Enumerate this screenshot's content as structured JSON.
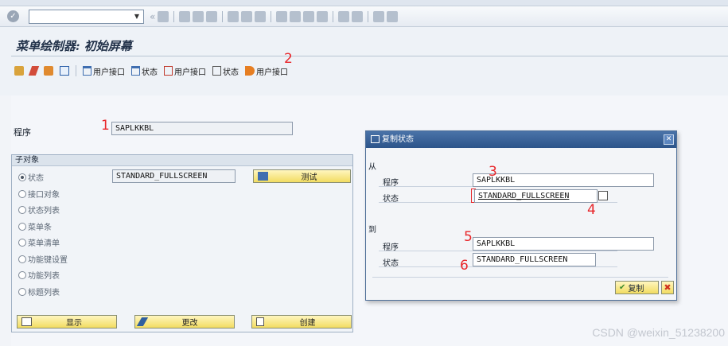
{
  "toolbar": {
    "ok_glyph": "✓",
    "command_field_value": "",
    "nav_glyph": "«"
  },
  "screen": {
    "title": "菜单绘制器: 初始屏幕"
  },
  "app_toolbar": {
    "items": [
      {
        "label": "用户接口",
        "icon": "trash-icon"
      },
      {
        "label": "状态",
        "icon": "trash-icon"
      },
      {
        "label": "用户接口",
        "icon": "copy-icon"
      },
      {
        "label": "状态",
        "icon": "copy-icon"
      },
      {
        "label": "用户接口",
        "icon": "properties-icon"
      }
    ]
  },
  "program": {
    "label": "程序",
    "value": "SAPLKKBL"
  },
  "subobjects": {
    "header": "子对象",
    "status_value": "STANDARD_FULLSCREEN",
    "radios": [
      {
        "label": "状态",
        "selected": true
      },
      {
        "label": "接口对象",
        "selected": false
      },
      {
        "label": "状态列表",
        "selected": false
      },
      {
        "label": "菜单条",
        "selected": false
      },
      {
        "label": "菜单清单",
        "selected": false
      },
      {
        "label": "功能键设置",
        "selected": false
      },
      {
        "label": "功能列表",
        "selected": false
      },
      {
        "label": "标题列表",
        "selected": false
      }
    ],
    "test_button": "测试"
  },
  "actions": {
    "display": "显示",
    "change": "更改",
    "create": "创建"
  },
  "dialog": {
    "title": "复制状态",
    "from_label": "从",
    "to_label": "到",
    "program_label": "程序",
    "status_label": "状态",
    "from_program": "SAPLKKBL",
    "from_status": "STANDARD_FULLSCREEN",
    "to_program": "SAPLKKBL",
    "to_status": "STANDARD_FULLSCREEN",
    "copy_button": "复制",
    "close_glyph": "✕",
    "cancel_glyph": "✖"
  },
  "annotations": [
    "1",
    "2",
    "3",
    "4",
    "5",
    "6"
  ],
  "watermark": "CSDN @weixin_51238200",
  "colors": {
    "annotation": "#e8262a",
    "dialog_title": "#2c548a",
    "button_yellow": "#f2dc61"
  }
}
